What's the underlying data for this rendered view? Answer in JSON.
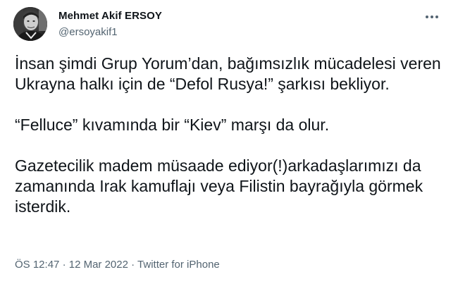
{
  "author": {
    "display_name": "Mehmet Akif ERSOY",
    "handle": "@ersoyakif1",
    "avatar_icon": "profile-photo"
  },
  "menu": {
    "more_icon": "more-horizontal-icon"
  },
  "tweet": {
    "paragraphs": [
      "İnsan şimdi Grup Yorum’dan, bağımsızlık mücadelesi veren Ukrayna halkı için de “Defol Rusya!” şarkısı bekliyor.",
      "“Felluce” kıvamında bir “Kiev” marşı da olur.",
      "Gazetecilik madem müsaade ediyor(!)arkadaşlarımızı da zamanında Irak kamuflajı veya Filistin bayrağıyla görmek isterdik."
    ],
    "time": "ÖS 12:47",
    "separator": "·",
    "date": "12 Mar 2022",
    "source": "Twitter for iPhone"
  },
  "colors": {
    "text_primary": "#0f1419",
    "text_secondary": "#536471",
    "background": "#ffffff"
  }
}
